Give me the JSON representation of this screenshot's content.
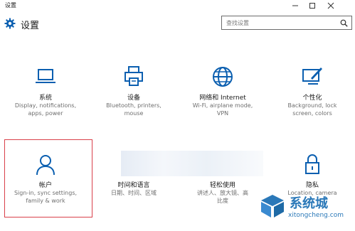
{
  "window": {
    "title": "设置"
  },
  "header": {
    "title": "设置",
    "icon": "gear-icon"
  },
  "search": {
    "placeholder": "查找设置",
    "icon": "search-icon"
  },
  "tiles": [
    {
      "id": "system",
      "title": "系统",
      "icon": "laptop-icon",
      "desc": [
        "Display, notifications,",
        "apps, power"
      ]
    },
    {
      "id": "devices",
      "title": "设备",
      "icon": "devices-icon",
      "desc": [
        "Bluetooth, printers,",
        "mouse"
      ]
    },
    {
      "id": "network",
      "title": "网络和 Internet",
      "icon": "globe-icon",
      "desc": [
        "Wi-Fi, airplane mode,",
        "VPN"
      ]
    },
    {
      "id": "personal",
      "title": "个性化",
      "icon": "paint-icon",
      "desc": [
        "Background, lock",
        "screen, colors"
      ]
    },
    {
      "id": "accounts",
      "title": "帐户",
      "icon": "person-icon",
      "desc": [
        "Sign-in, sync settings,",
        "family & work"
      ]
    },
    {
      "id": "time",
      "title": "时间和语言",
      "icon": "time-icon",
      "desc": [
        "日期、时间、区域"
      ]
    },
    {
      "id": "ease",
      "title": "轻松使用",
      "icon": "ease-icon",
      "desc": [
        "讲述人、放大镜、高",
        "比度"
      ]
    },
    {
      "id": "privacy",
      "title": "隐私",
      "icon": "lock-icon",
      "desc": [
        "Location, camera"
      ]
    }
  ],
  "watermark": {
    "text": "系统城",
    "url": "xitongcheng.com"
  },
  "colors": {
    "accent": "#0b5fb0",
    "selection": "#d9404a"
  }
}
